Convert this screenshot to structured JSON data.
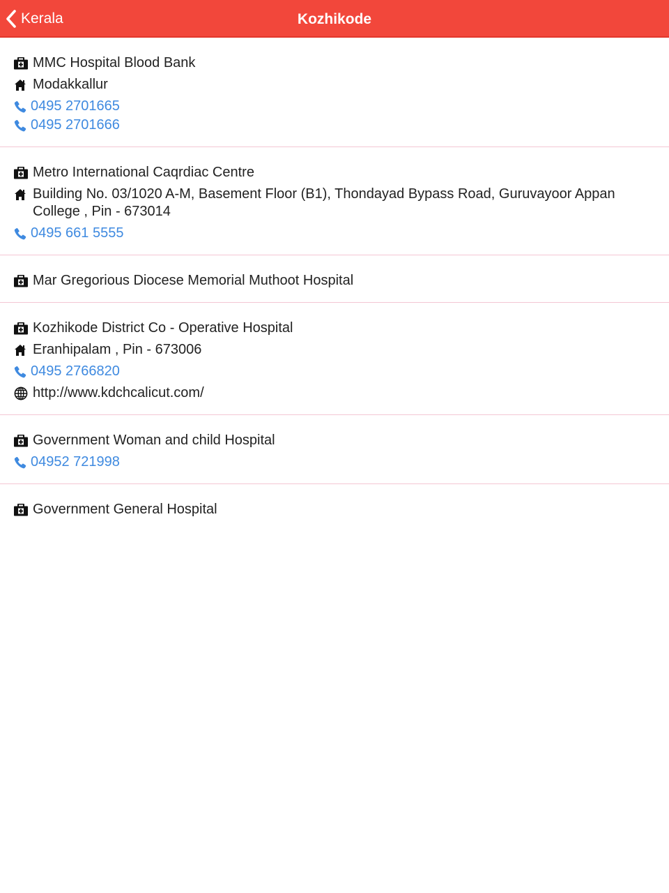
{
  "navbar": {
    "back_label": "Kerala",
    "title": "Kozhikode",
    "background": "#f2473b"
  },
  "colors": {
    "link": "#3f8ae0",
    "divider": "#f4c6d4"
  },
  "icons": {
    "name": "medkit-icon",
    "address": "home-icon",
    "phone": "phone-icon",
    "website": "globe-icon"
  },
  "hospitals": [
    {
      "name": "MMC Hospital Blood Bank",
      "address": "Modakkallur",
      "phones": [
        "0495 2701665",
        "0495 2701666"
      ]
    },
    {
      "name": "Metro International Caqrdiac Centre",
      "address": "Building No. 03/1020 A-M, Basement Floor (B1), Thondayad Bypass Road, Guruvayoor Appan College , Pin - 673014",
      "phones": [
        "0495 661 5555"
      ]
    },
    {
      "name": "Mar Gregorious Diocese Memorial Muthoot Hospital"
    },
    {
      "name": "Kozhikode District Co - Operative Hospital",
      "address": "Eranhipalam , Pin - 673006",
      "phones": [
        "0495 2766820"
      ],
      "website": "http://www.kdchcalicut.com/"
    },
    {
      "name": "Government Woman and child Hospital",
      "phones": [
        "04952 721998"
      ]
    },
    {
      "name": "Government General Hospital"
    }
  ]
}
